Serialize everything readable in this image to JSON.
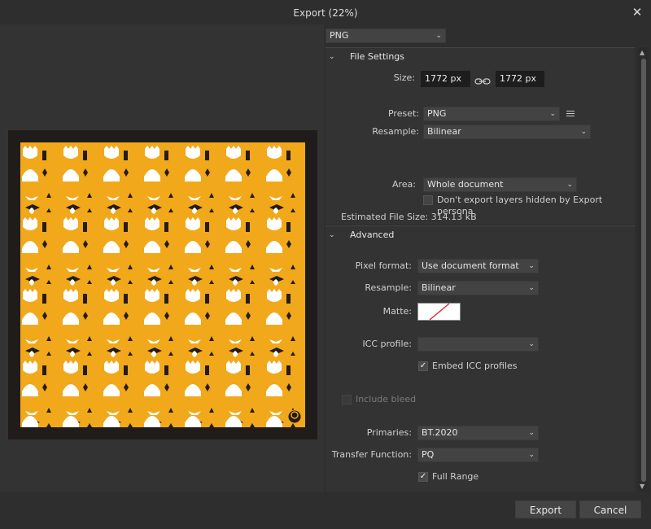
{
  "window": {
    "title": "Export (22%)"
  },
  "format": {
    "selected": "PNG"
  },
  "file_settings": {
    "header": "File Settings",
    "size_label": "Size:",
    "width": "1772 px",
    "height": "1772 px",
    "preset_label": "Preset:",
    "preset": "PNG",
    "resample_label": "Resample:",
    "resample": "Bilinear",
    "area_label": "Area:",
    "area": "Whole document",
    "hidden_layers_label": "Don't export layers hidden by Export persona",
    "estimated_label": "Estimated File Size: 314.13 kB"
  },
  "advanced": {
    "header": "Advanced",
    "pixel_format_label": "Pixel format:",
    "pixel_format": "Use document format",
    "resample_label": "Resample:",
    "resample": "Bilinear",
    "matte_label": "Matte:",
    "icc_profile_label": "ICC profile:",
    "icc_profile": "",
    "embed_icc_label": "Embed ICC profiles",
    "include_bleed_label": "Include bleed",
    "primaries_label": "Primaries:",
    "primaries": "BT.2020",
    "transfer_label": "Transfer Function:",
    "transfer": "PQ",
    "full_range_label": "Full Range"
  },
  "buttons": {
    "export": "Export",
    "cancel": "Cancel"
  },
  "colors": {
    "artwork_bg": "#f2a81b",
    "artboard_border": "#201c1c",
    "accent_white": "#ffffff",
    "accent_dark": "#241c1c"
  }
}
